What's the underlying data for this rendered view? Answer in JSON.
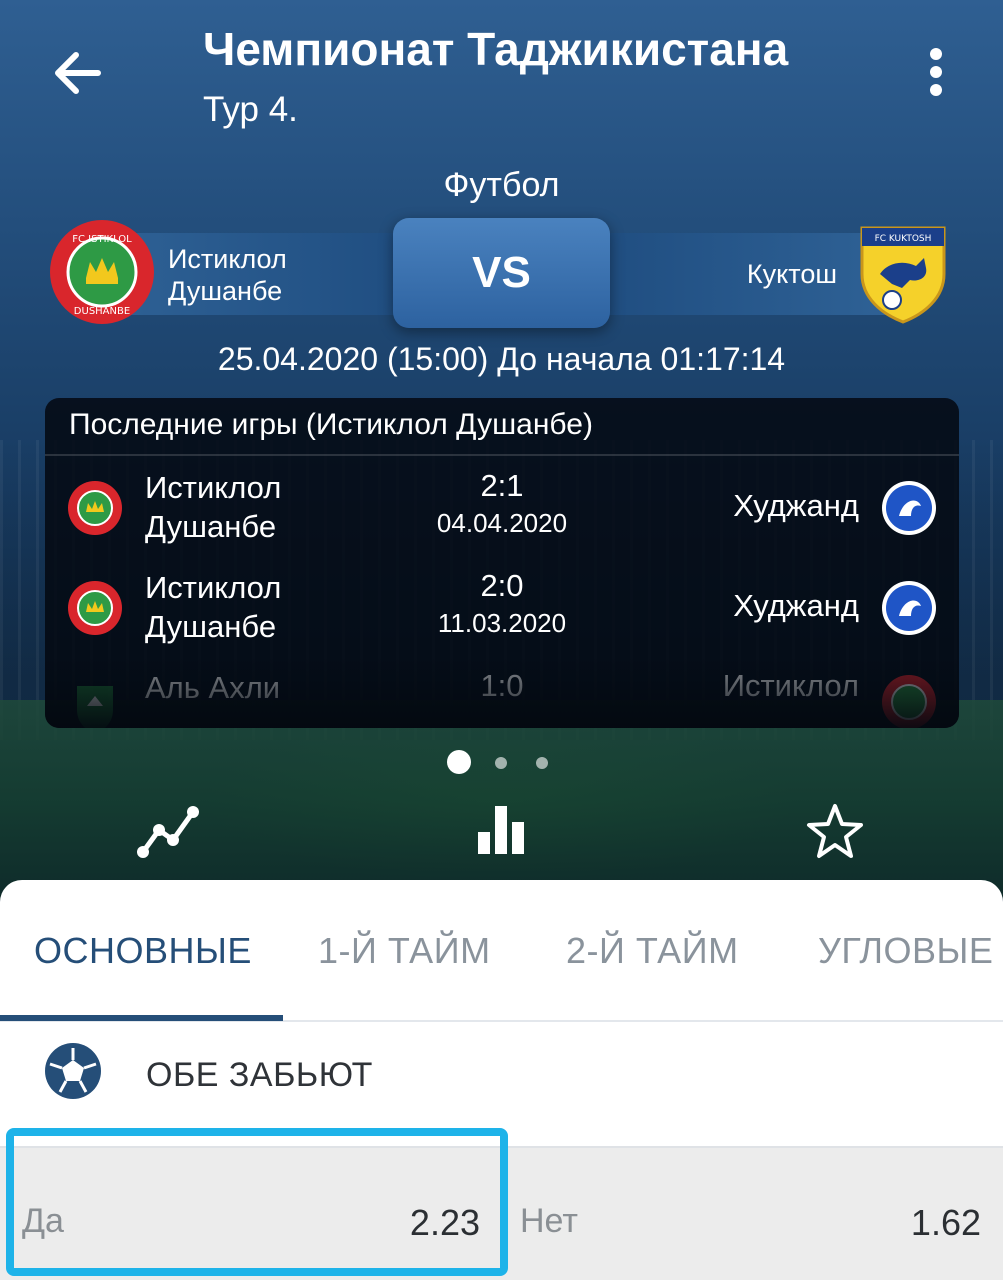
{
  "header": {
    "title": "Чемпионат Таджикистана",
    "subtitle": "Тур 4.",
    "sport": "Футбол"
  },
  "match": {
    "home_team": "Истиклол\nДушанбе",
    "vs_label": "VS",
    "away_team": "Куктош",
    "datetime": "25.04.2020 (15:00)  До начала 01:17:14",
    "home_logo_text": "FC ISTIKLOL DUSHANBE 2007",
    "away_logo_text": "FC KUKTOSH"
  },
  "last_games": {
    "header": "Последние игры (Истиклол Душанбе)",
    "games": [
      {
        "home": "Истиклол\nДушанбе",
        "score": "2:1",
        "date": "04.04.2020",
        "away": "Худжанд"
      },
      {
        "home": "Истиклол\nДушанбе",
        "score": "2:0",
        "date": "11.03.2020",
        "away": "Худжанд"
      },
      {
        "home": "Аль Ахли",
        "score": "1:0",
        "date": "",
        "away": "Истиклол"
      }
    ]
  },
  "pager": {
    "current": 1,
    "total": 3
  },
  "toolbar": {
    "icons": [
      "line-chart-icon",
      "bar-chart-icon",
      "star-icon"
    ]
  },
  "tabs": [
    {
      "label": "ОСНОВНЫЕ",
      "active": true
    },
    {
      "label": "1-Й ТАЙМ",
      "active": false
    },
    {
      "label": "2-Й ТАЙМ",
      "active": false
    },
    {
      "label": "УГЛОВЫЕ",
      "active": false
    }
  ],
  "market": {
    "title": "ОБЕ ЗАБЬЮТ",
    "outcomes": [
      {
        "label": "Да",
        "odd": "2.23",
        "highlighted": true
      },
      {
        "label": "Нет",
        "odd": "1.62",
        "highlighted": false
      }
    ]
  },
  "colors": {
    "accent": "#254e78",
    "highlight": "#1eb3e9",
    "header_bg": "#234e7c"
  }
}
